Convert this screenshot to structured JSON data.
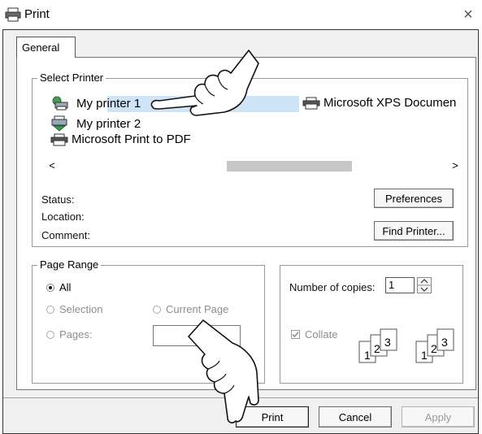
{
  "window": {
    "title": "Print",
    "close_glyph": "×"
  },
  "tabs": [
    {
      "label": "General"
    }
  ],
  "select_printer": {
    "group_label": "Select Printer",
    "printers": [
      {
        "name": "My printer 1",
        "icon": "printer-network-icon",
        "selected": true
      },
      {
        "name": "My printer 2",
        "icon": "printer-shared-icon"
      },
      {
        "name": "Microsoft Print to PDF",
        "icon": "printer-icon"
      },
      {
        "name": "Microsoft XPS Documen",
        "icon": "printer-icon"
      }
    ],
    "scroll_left": "<",
    "scroll_right": ">",
    "status_label": "Status:",
    "location_label": "Location:",
    "comment_label": "Comment:",
    "preferences_button": "Preferences",
    "find_printer_button": "Find Printer..."
  },
  "page_range": {
    "group_label": "Page Range",
    "all": "All",
    "selection": "Selection",
    "current_page": "Current Page",
    "pages": "Pages:",
    "selected_option": "All"
  },
  "copies": {
    "label": "Number of copies:",
    "value": "1",
    "collate_label": "Collate",
    "collate_checked": true,
    "collate_icon_pages": [
      "1",
      "2",
      "3"
    ]
  },
  "footer": {
    "print": "Print",
    "cancel": "Cancel",
    "apply": "Apply"
  },
  "annotations": {
    "pointer_icon": "pointing-hand-icon"
  }
}
